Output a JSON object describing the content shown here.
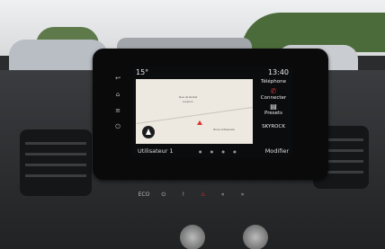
{
  "status": {
    "temperature": "15°",
    "time": "13:40"
  },
  "map": {
    "labels": [
      "Rue de Ruitet",
      "Loupinx",
      "Zone Artisanale"
    ]
  },
  "right_panel": {
    "items": [
      {
        "title": "Téléphone",
        "label": "Connecter",
        "icon": "phone-icon"
      },
      {
        "title": "Presets",
        "label": "",
        "icon": "radio-icon"
      },
      {
        "title": "SKYROCK",
        "label": "Modifier",
        "icon": "radio-station-icon"
      }
    ]
  },
  "bottom": {
    "user": "Utilisateur 1",
    "modify": "Modifier"
  },
  "button_strip": [
    "ECO",
    "⏻",
    "!",
    "⚠",
    "«",
    "»"
  ],
  "colors": {
    "accent": "#e2363a"
  }
}
